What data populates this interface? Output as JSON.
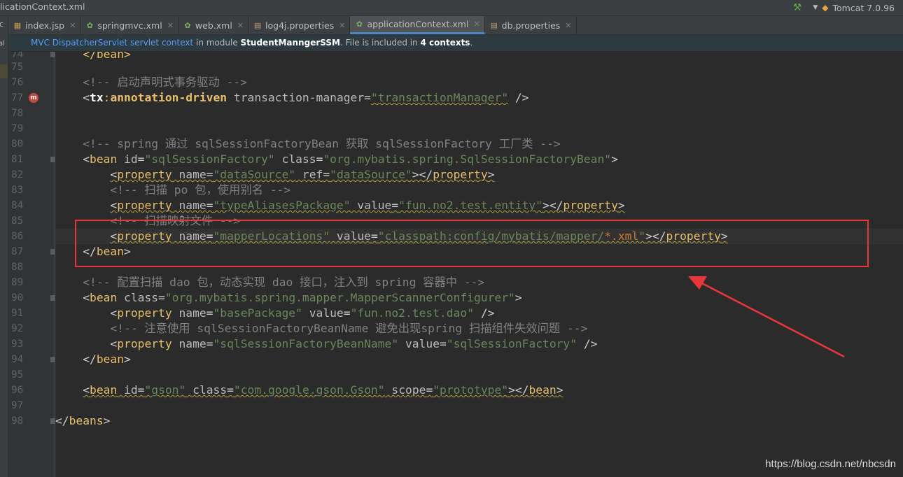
{
  "window": {
    "title": "licationContext.xml",
    "run_config": "Tomcat 7.0.96",
    "run_config_icon": "tomcat-icon",
    "build_icon": "hammer-icon"
  },
  "left_strip": {
    "text1": "c",
    "text2": "al"
  },
  "tabs": [
    {
      "label": "index.jsp",
      "icon": "jsp-file-icon",
      "active": false
    },
    {
      "label": "springmvc.xml",
      "icon": "spring-xml-icon",
      "active": false
    },
    {
      "label": "web.xml",
      "icon": "spring-xml-icon",
      "active": false
    },
    {
      "label": "log4j.properties",
      "icon": "properties-file-icon",
      "active": false
    },
    {
      "label": "applicationContext.xml",
      "icon": "spring-xml-icon",
      "active": true
    },
    {
      "label": "db.properties",
      "icon": "properties-file-icon",
      "active": false
    }
  ],
  "banner": {
    "link": "MVC DispatcherServlet servlet context",
    "text1": " in module ",
    "module": "StudentManngerSSM",
    "text2": ". File is included in ",
    "count": "4 contexts",
    "text3": "."
  },
  "editor": {
    "line_numbers": [
      "74",
      "75",
      "76",
      "77",
      "78",
      "79",
      "80",
      "81",
      "82",
      "83",
      "84",
      "85",
      "86",
      "87",
      "88",
      "89",
      "90",
      "91",
      "92",
      "93",
      "94",
      "95",
      "96",
      "97",
      "98"
    ],
    "current_line": "86"
  },
  "code": {
    "l74": {
      "t1": "    </bean>"
    },
    "l76": {
      "comment": "<!-- 启动声明式事务驱动 -->"
    },
    "l77": {
      "p1": "<",
      "ns": "tx",
      "colon": ":",
      "tag": "annotation-driven",
      "sp": " ",
      "attr": "transaction-manager",
      "eq": "=",
      "val": "\"transactionManager\"",
      "end": " />"
    },
    "l80": {
      "comment": "<!-- spring 通过 sqlSessionFactoryBean 获取 sqlSessionFactory 工厂类 -->"
    },
    "l81": {
      "lt": "<",
      "tag": "bean",
      "a1": " id",
      "eq1": "=",
      "v1": "\"sqlSessionFactory\"",
      "a2": " class",
      "eq2": "=",
      "v2": "\"org.mybatis.spring.SqlSessionFactoryBean\"",
      "gt": ">"
    },
    "l82": {
      "lt": "<",
      "tag": "property",
      "a1": " name",
      "eq1": "=",
      "v1": "\"dataSource\"",
      "a2": " ref",
      "eq2": "=",
      "v2": "\"dataSource\"",
      "close": "></",
      "tag2": "property",
      "gt": ">"
    },
    "l83": {
      "comment": "<!-- 扫描 po 包，使用别名 -->"
    },
    "l84": {
      "lt": "<",
      "tag": "property",
      "a1": " name",
      "eq1": "=",
      "v1": "\"typeAliasesPackage\"",
      "a2": " value",
      "eq2": "=",
      "v2": "\"fun.no2.test.entity\"",
      "close": "></",
      "tag2": "property",
      "gt": ">"
    },
    "l85": {
      "comment": "<!-- 扫描映射文件 -->"
    },
    "l86": {
      "lt": "<",
      "tag": "property",
      "a1": " name",
      "eq1": "=",
      "v1": "\"mapperLocations\"",
      "a2": " value",
      "eq2": "=",
      "v2a": "\"classpath:config/mybatis/mapper/",
      "v2b": "*.xml",
      "v2c": "\"",
      "close": "></",
      "tag2": "property",
      "gt": ">"
    },
    "l87": {
      "lt": "</",
      "tag": "bean",
      "gt": ">"
    },
    "l89": {
      "comment": "<!-- 配置扫描 dao 包，动态实现 dao 接口，注入到 spring 容器中 -->"
    },
    "l90": {
      "lt": "<",
      "tag": "bean",
      "a1": " class",
      "eq1": "=",
      "v1": "\"org.mybatis.spring.mapper.MapperScannerConfigurer\"",
      "gt": ">"
    },
    "l91": {
      "lt": "<",
      "tag": "property",
      "a1": " name",
      "eq1": "=",
      "v1": "\"basePackage\"",
      "a2": " value",
      "eq2": "=",
      "v2": "\"fun.no2.test.dao\"",
      "end": " />"
    },
    "l92": {
      "comment": "<!-- 注意使用 sqlSessionFactoryBeanName 避免出现spring 扫描组件失效问题 -->"
    },
    "l93": {
      "lt": "<",
      "tag": "property",
      "a1": " name",
      "eq1": "=",
      "v1": "\"sqlSessionFactoryBeanName\"",
      "a2": " value",
      "eq2": "=",
      "v2": "\"sqlSessionFactory\"",
      "end": " />"
    },
    "l94": {
      "lt": "</",
      "tag": "bean",
      "gt": ">"
    },
    "l96": {
      "lt": "<",
      "tag": "bean",
      "a1": " id",
      "eq1": "=",
      "v1": "\"gson\"",
      "a2": " class",
      "eq2": "=",
      "v2": "\"com.google.gson.Gson\"",
      "a3": " scope",
      "eq3": "=",
      "v3": "\"prototype\"",
      "close": "></",
      "tag2": "bean",
      "gt": ">"
    },
    "l98": {
      "lt": "</",
      "tag": "beans",
      "gt": ">"
    }
  },
  "annotation": {
    "box_color": "#e8363b",
    "arrow_color": "#e8363b"
  },
  "watermark": "https://blog.csdn.net/nbcsdn"
}
